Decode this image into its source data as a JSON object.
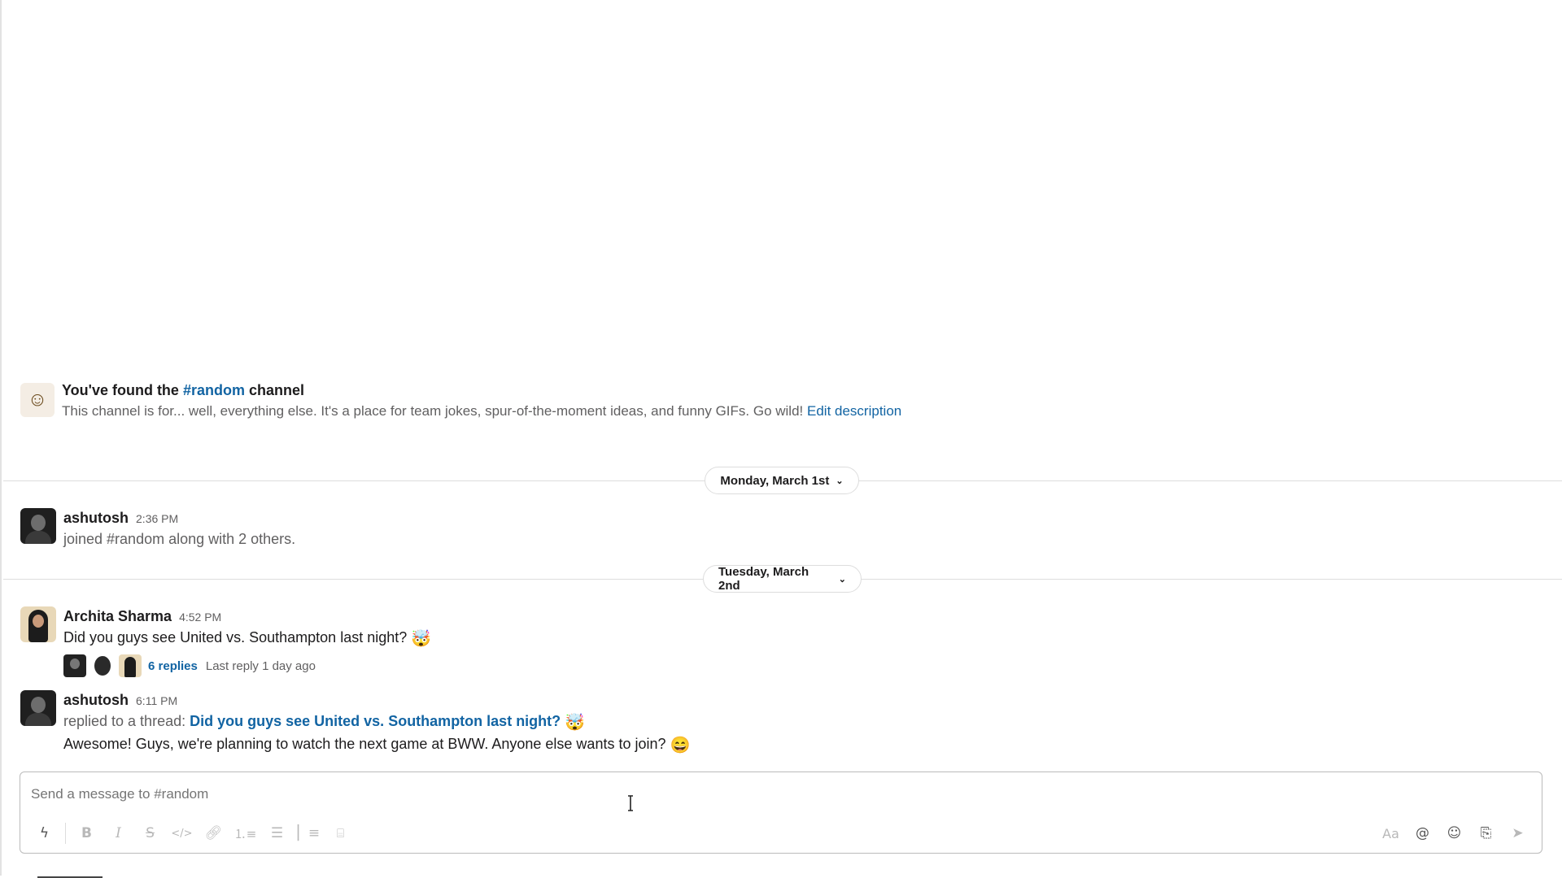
{
  "intro": {
    "icon": "smiley-icon",
    "title_prefix": "You've found the",
    "channel": "#random",
    "title_suffix": "channel",
    "description": "This channel is for... well, everything else. It's a place for team jokes, spur-of-the-moment ideas, and funny GIFs. Go wild!",
    "edit_link": "Edit description"
  },
  "dividers": [
    {
      "label": "Monday, March 1st"
    },
    {
      "label": "Tuesday, March 2nd"
    }
  ],
  "messages": [
    {
      "name": "ashutosh",
      "time": "2:36 PM",
      "text": "joined #random along with 2 others."
    },
    {
      "name": "Archita Sharma",
      "time": "4:52 PM",
      "text": "Did you guys see United vs. Southampton last night?",
      "emoji": "🤯",
      "thread": {
        "replies": "6 replies",
        "last_reply": "Last reply 1 day ago"
      }
    },
    {
      "name": "ashutosh",
      "time": "6:11 PM",
      "replied_prefix": "replied to a thread:",
      "thread_link": "Did you guys see United vs. Southampton last night?",
      "thread_emoji": "🤯",
      "text": "Awesome! Guys, we're planning to watch the next game at BWW. Anyone else wants to join?",
      "emoji": "😄"
    }
  ],
  "composer": {
    "placeholder": "Send a message to #random",
    "toolbar_left": [
      "lightning-icon",
      "bold-icon",
      "italic-icon",
      "strikethrough-icon",
      "code-icon",
      "link-icon",
      "numbered-list-icon",
      "bulleted-list-icon",
      "blockquote-icon",
      "code-block-icon"
    ],
    "toolbar_right": [
      "formatting-icon",
      "mention-icon",
      "emoji-icon",
      "attachment-icon",
      "send-icon"
    ]
  },
  "colors": {
    "link": "#1264a3",
    "muted": "#616061",
    "divider": "#dddddd"
  }
}
